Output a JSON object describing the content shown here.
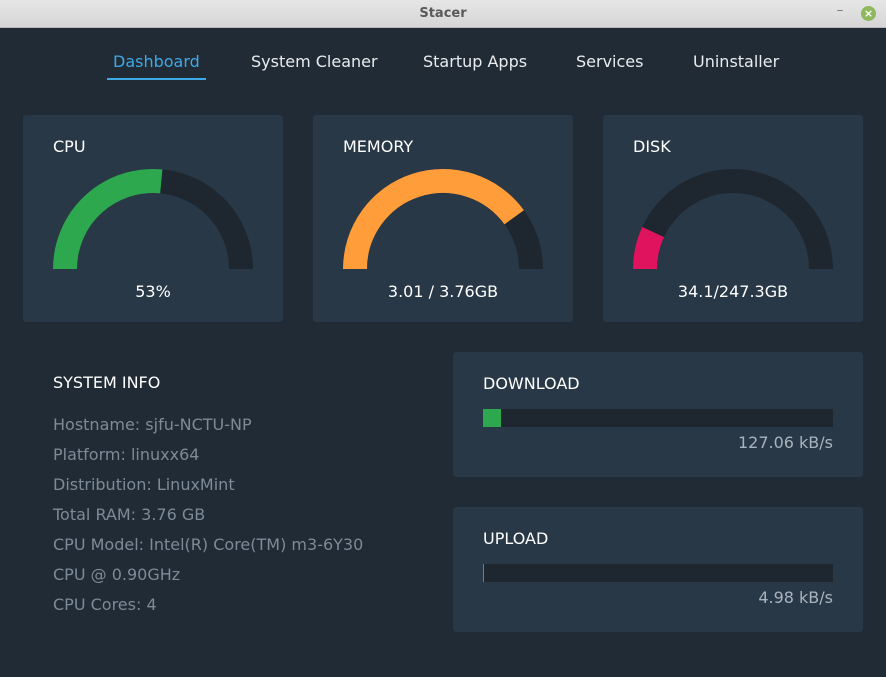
{
  "window": {
    "title": "Stacer",
    "minimize_icon": "minimize-icon",
    "close_icon": "close-icon",
    "close_color": "#8fb85e"
  },
  "tabs": [
    {
      "label": "Dashboard",
      "active": true
    },
    {
      "label": "System Cleaner",
      "active": false
    },
    {
      "label": "Startup Apps",
      "active": false
    },
    {
      "label": "Services",
      "active": false
    },
    {
      "label": "Uninstaller",
      "active": false
    }
  ],
  "gauges": {
    "cpu": {
      "title": "CPU",
      "value": "53%",
      "fraction": 0.53,
      "color": "#2ea84f"
    },
    "memory": {
      "title": "MEMORY",
      "value": "3.01 / 3.76GB",
      "fraction": 0.8,
      "color": "#ff9d3a"
    },
    "disk": {
      "title": "DISK",
      "value": "34.1/247.3GB",
      "fraction": 0.138,
      "color": "#e0145e"
    }
  },
  "system_info": {
    "title": "SYSTEM INFO",
    "lines": [
      "Hostname: sjfu-NCTU-NP",
      "Platform: linuxx64",
      "Distribution: LinuxMint",
      "Total RAM: 3.76 GB",
      "CPU Model: Intel(R) Core(TM) m3-6Y30",
      "CPU @ 0.90GHz",
      "CPU Cores: 4"
    ]
  },
  "download": {
    "title": "DOWNLOAD",
    "speed": "127.06 kB/s",
    "fraction": 0.05,
    "color": "#2ea84f"
  },
  "upload": {
    "title": "UPLOAD",
    "speed": "4.98 kB/s",
    "fraction": 0.004,
    "color": "#2ea84f"
  },
  "colors": {
    "background": "#212b35",
    "card": "#283846",
    "gauge_track": "#1e2730",
    "accent": "#3fa9e6"
  }
}
